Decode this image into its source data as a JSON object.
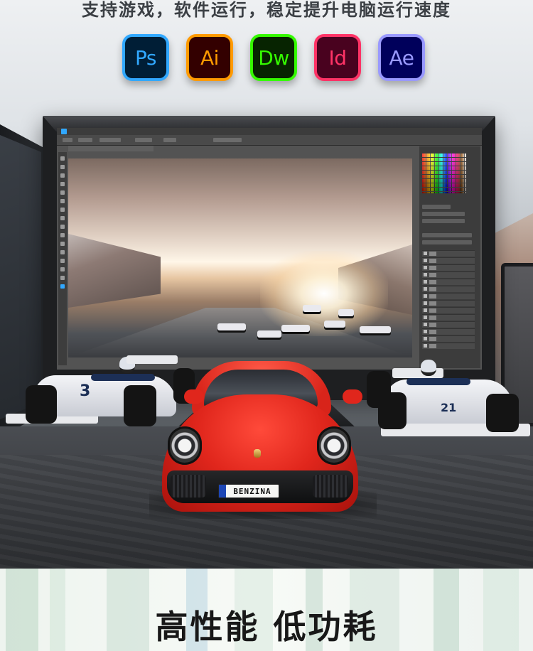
{
  "header": {
    "tagline": "支持游戏，软件运行，稳定提升电脑运行速度"
  },
  "apps": [
    {
      "label": "Ps",
      "icon": "photoshop-icon",
      "color": "#31a8ff"
    },
    {
      "label": "Ai",
      "icon": "illustrator-icon",
      "color": "#ff9a00"
    },
    {
      "label": "Dw",
      "icon": "dreamweaver-icon",
      "color": "#35fa00"
    },
    {
      "label": "Id",
      "icon": "indesign-icon",
      "color": "#ff3366"
    },
    {
      "label": "Ae",
      "icon": "after-effects-icon",
      "color": "#9999ff"
    }
  ],
  "scene": {
    "plate_text": "BENZINA",
    "f1_left_number": "3",
    "f1_right_number": "21",
    "car_color": "#e0261c"
  },
  "banner": {
    "title": "高性能 低功耗"
  }
}
